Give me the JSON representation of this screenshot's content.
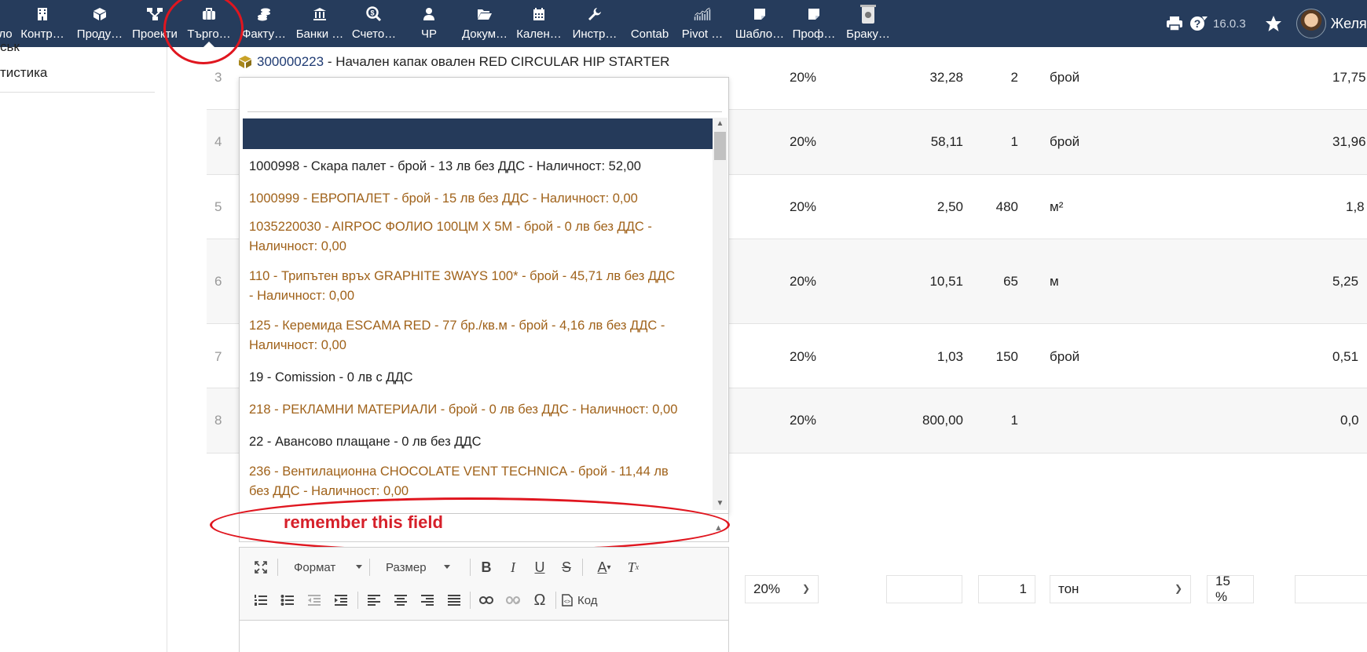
{
  "topbar": {
    "nav": [
      {
        "label": "ло",
        "icon": "home-icon"
      },
      {
        "label": "Контр…",
        "icon": "building-icon"
      },
      {
        "label": "Проду…",
        "icon": "box-icon"
      },
      {
        "label": "Проекти",
        "icon": "project-tree-icon"
      },
      {
        "label": "Търго…",
        "icon": "briefcase-icon"
      },
      {
        "label": "Факту…",
        "icon": "coins-icon"
      },
      {
        "label": "Банки …",
        "icon": "bank-icon"
      },
      {
        "label": "Счето…",
        "icon": "search-dollar-icon"
      },
      {
        "label": "ЧР",
        "icon": "user-tie-icon"
      },
      {
        "label": "Докум…",
        "icon": "folder-open-icon"
      },
      {
        "label": "Кален…",
        "icon": "calendar-icon"
      },
      {
        "label": "Инстр…",
        "icon": "wrench-icon"
      },
      {
        "label": "Contab",
        "icon": ""
      },
      {
        "label": "Pivot …",
        "icon": "chart-icon"
      },
      {
        "label": "Шабло…",
        "icon": "sticky-note-icon"
      },
      {
        "label": "Проф…",
        "icon": "sticky-note-icon"
      },
      {
        "label": "Браку…",
        "icon": "trash-icon"
      }
    ],
    "version": "16.0.3",
    "user_name": "Желя"
  },
  "sidebar": {
    "items": [
      "ськ",
      "тистика"
    ]
  },
  "product_line": {
    "code": "300000223",
    "separator": " - ",
    "name": "Начален капак овален RED CIRCULAR HIP STARTER"
  },
  "rows": [
    {
      "num": "3",
      "vat": "20%",
      "price": "32,28",
      "qty": "2",
      "unit": "брой",
      "total": "17,75"
    },
    {
      "num": "4",
      "vat": "20%",
      "price": "58,11",
      "qty": "1",
      "unit": "брой",
      "total": "31,96"
    },
    {
      "num": "5",
      "vat": "20%",
      "price": "2,50",
      "qty": "480",
      "unit": "м²",
      "total": "1,8"
    },
    {
      "num": "6",
      "vat": "20%",
      "price": "10,51",
      "qty": "65",
      "unit": "м",
      "total": "5,25"
    },
    {
      "num": "7",
      "vat": "20%",
      "price": "1,03",
      "qty": "150",
      "unit": "брой",
      "total": "0,51"
    },
    {
      "num": "8",
      "vat": "20%",
      "price": "800,00",
      "qty": "1",
      "unit": "",
      "total": "0,0"
    }
  ],
  "dropdown": {
    "options": [
      {
        "line1": "1000998 - Скара палет - брой - 13 лв без ДДС - Наличност: 52,00",
        "line2": "",
        "style": "dark"
      },
      {
        "line1": "1000999 - ЕВРОПАЛЕТ - брой - 15 лв без ДДС - Наличност: 0,00",
        "line2": "",
        "style": "brown"
      },
      {
        "line1": "1035220030 - AIRPOC ФОЛИО 100ЦМ X 5М - брой - 0 лв без ДДС -",
        "line2": "Наличност: 0,00",
        "style": "brown"
      },
      {
        "line1": "110 - Трипътен връх GRAPHITE 3WAYS 100* - брой - 45,71 лв без ДДС",
        "line2": "- Наличност: 0,00",
        "style": "brown"
      },
      {
        "line1": "125 - Керемида ESCAMA RED - 77 бр./кв.м - брой - 4,16 лв без ДДС -",
        "line2": "Наличност: 0,00",
        "style": "brown"
      },
      {
        "line1": "19 - Comission - 0 лв с ДДС",
        "line2": "",
        "style": "dark"
      },
      {
        "line1": "218 - РЕКЛАМНИ МАТЕРИАЛИ - брой - 0 лв без ДДС - Наличност: 0,00",
        "line2": "",
        "style": "brown"
      },
      {
        "line1": "22 - Авансово плащане - 0 лв без ДДС",
        "line2": "",
        "style": "dark"
      },
      {
        "line1": "236 - Вентилационна CHOCOLATE VENT TECHNICA - брой - 11,44 лв",
        "line2": "без ДДС - Наличност: 0,00",
        "style": "brown"
      }
    ]
  },
  "annotation": {
    "text": "remember this field"
  },
  "editor": {
    "format_label": "Формат",
    "size_label": "Размер",
    "source_label": "Код"
  },
  "bottom_row": {
    "vat_select": "20%",
    "qty": "1",
    "unit_select": "тон",
    "discount": "15 %"
  }
}
